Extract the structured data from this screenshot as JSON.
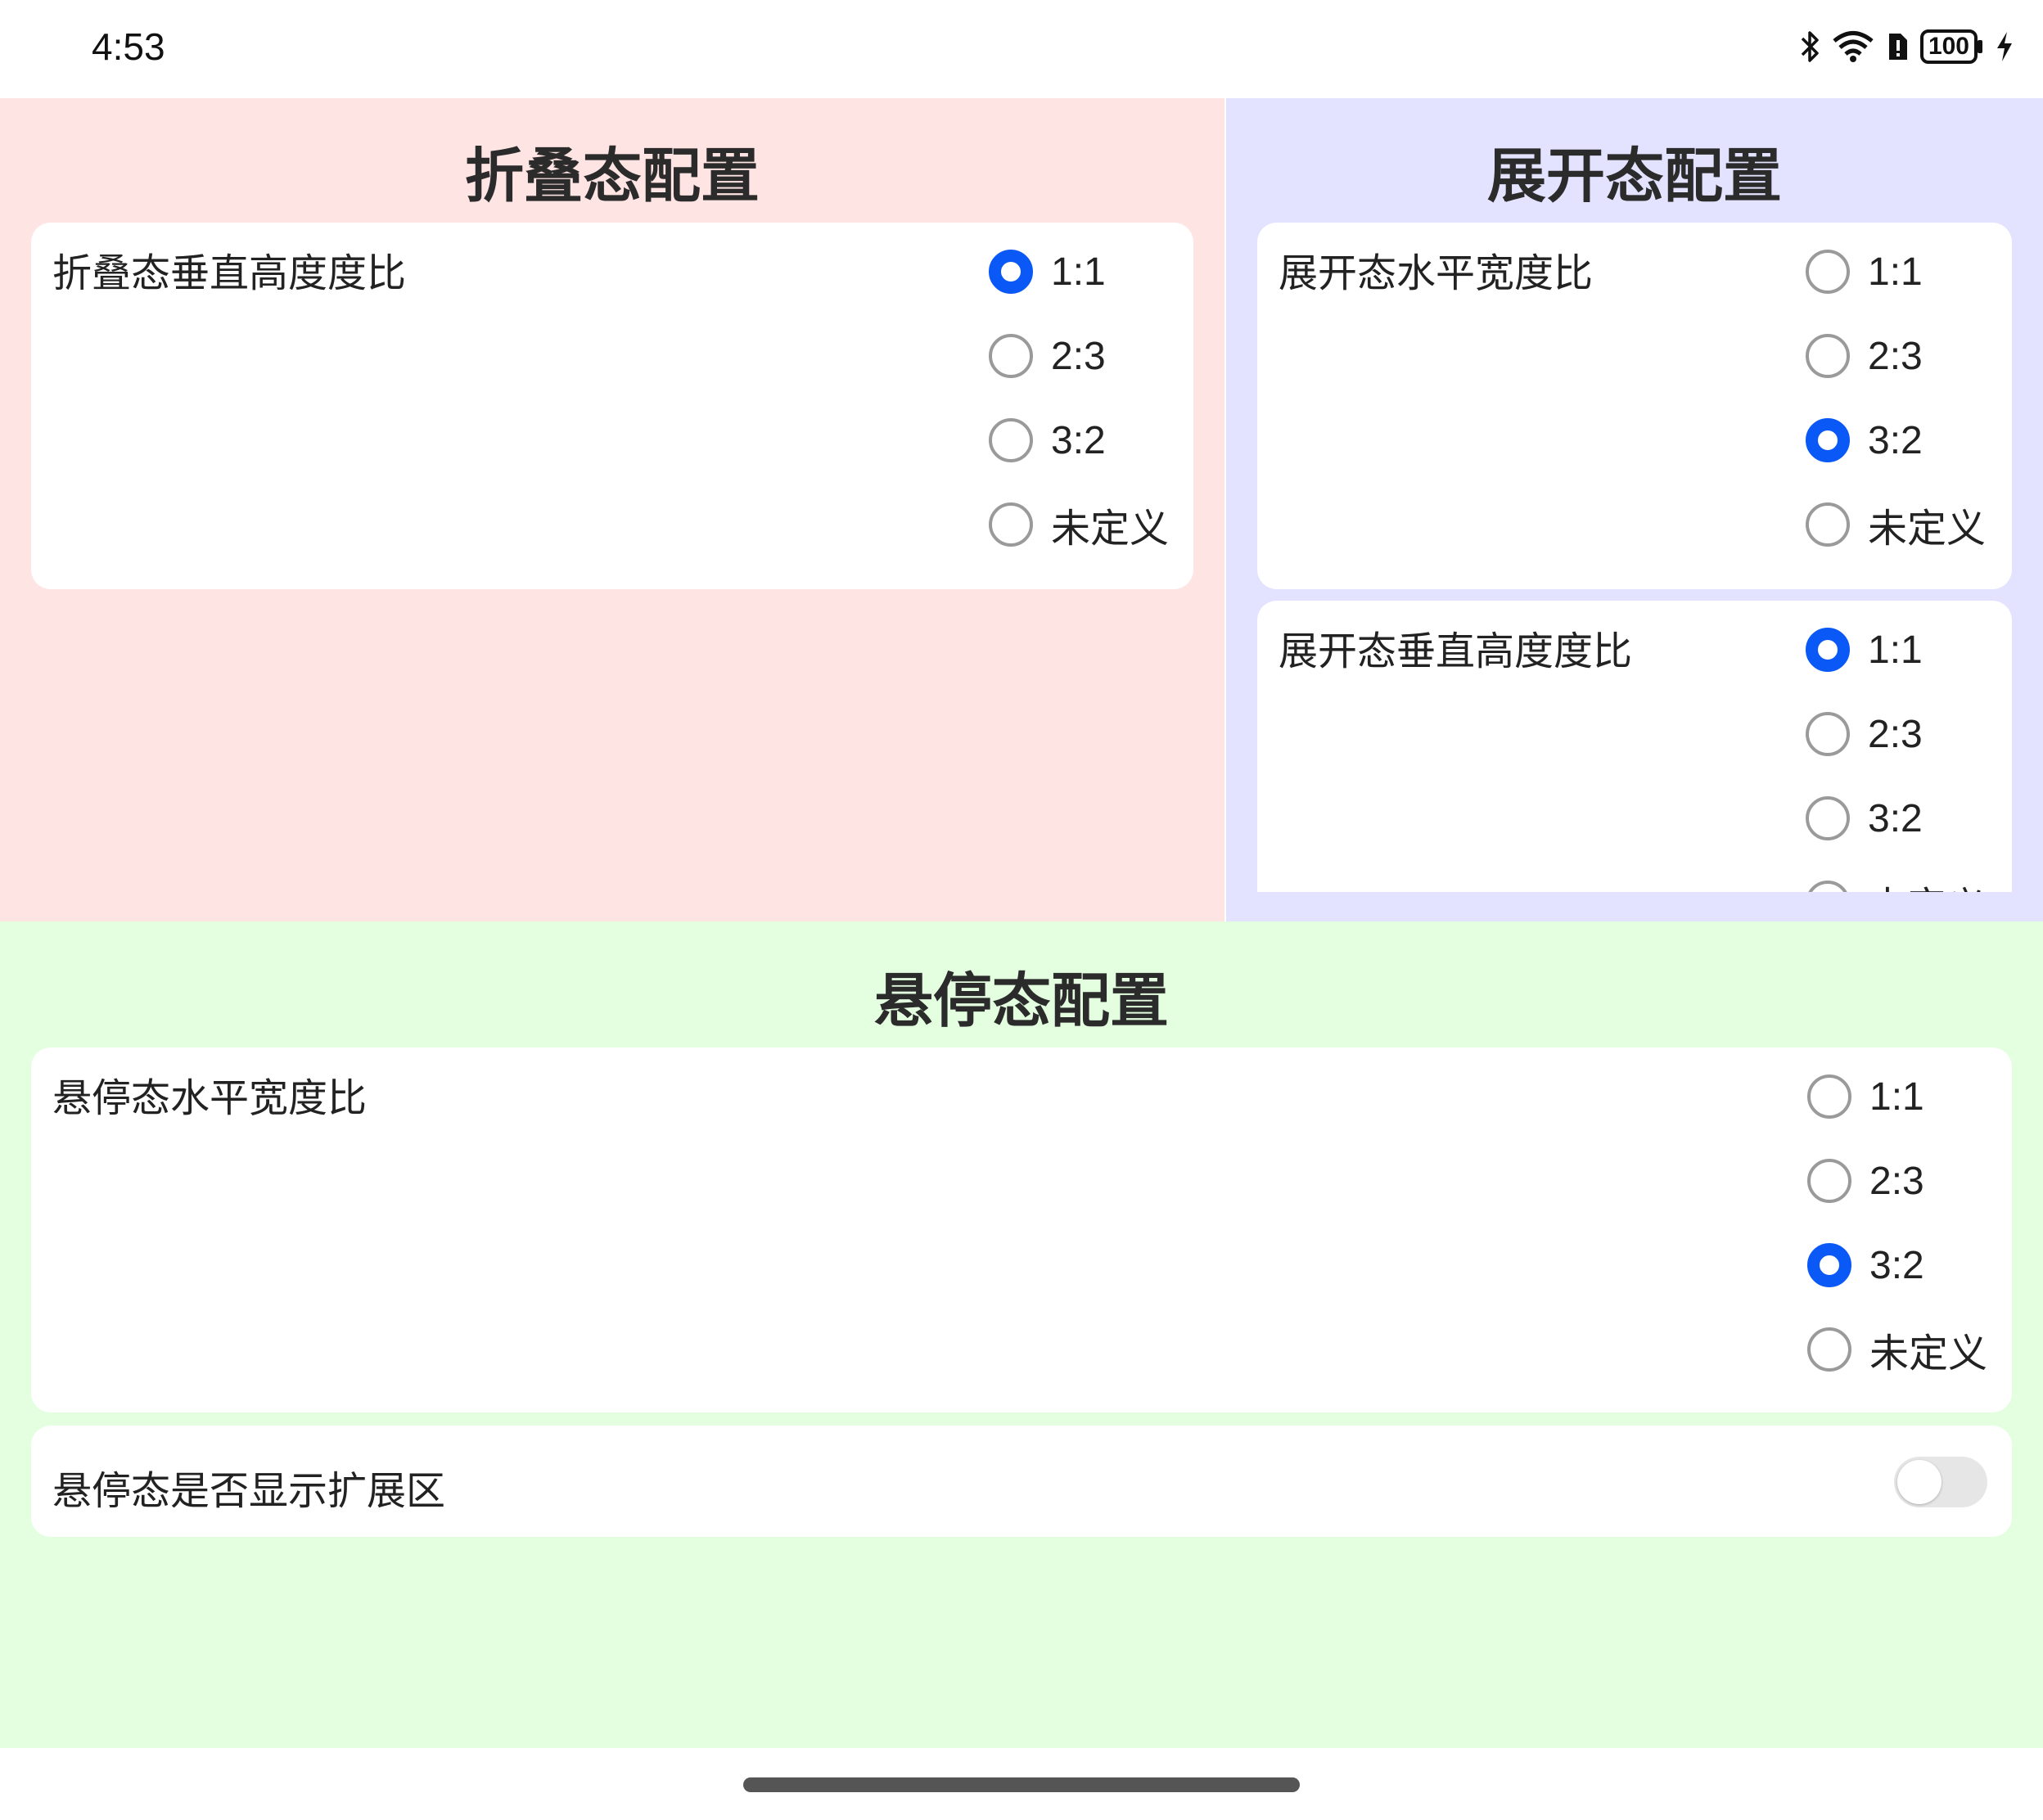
{
  "status_bar": {
    "time": "4:53",
    "battery": "100",
    "icons": [
      "bluetooth-icon",
      "wifi-icon",
      "sim-alert-icon",
      "battery-icon",
      "charging-icon"
    ]
  },
  "folded": {
    "title": "折叠态配置",
    "vertical": {
      "label": "折叠态垂直高度度比",
      "options": [
        "1:1",
        "2:3",
        "3:2",
        "未定义"
      ],
      "selected": "1:1"
    }
  },
  "unfolded": {
    "title": "展开态配置",
    "horizontal": {
      "label": "展开态水平宽度比",
      "options": [
        "1:1",
        "2:3",
        "3:2",
        "未定义"
      ],
      "selected": "3:2"
    },
    "vertical": {
      "label": "展开态垂直高度度比",
      "options": [
        "1:1",
        "2:3",
        "3:2",
        "未定义"
      ],
      "selected": "1:1"
    }
  },
  "hover": {
    "title": "悬停态配置",
    "horizontal": {
      "label": "悬停态水平宽度比",
      "options": [
        "1:1",
        "2:3",
        "3:2",
        "未定义"
      ],
      "selected": "3:2"
    },
    "show_extension": {
      "label": "悬停态是否显示扩展区",
      "on": false
    }
  },
  "colors": {
    "accent": "#0a59f7",
    "folded_bg": "#ffe4e4",
    "unfolded_bg": "#e3e3ff",
    "hover_bg": "#e3ffe0"
  }
}
